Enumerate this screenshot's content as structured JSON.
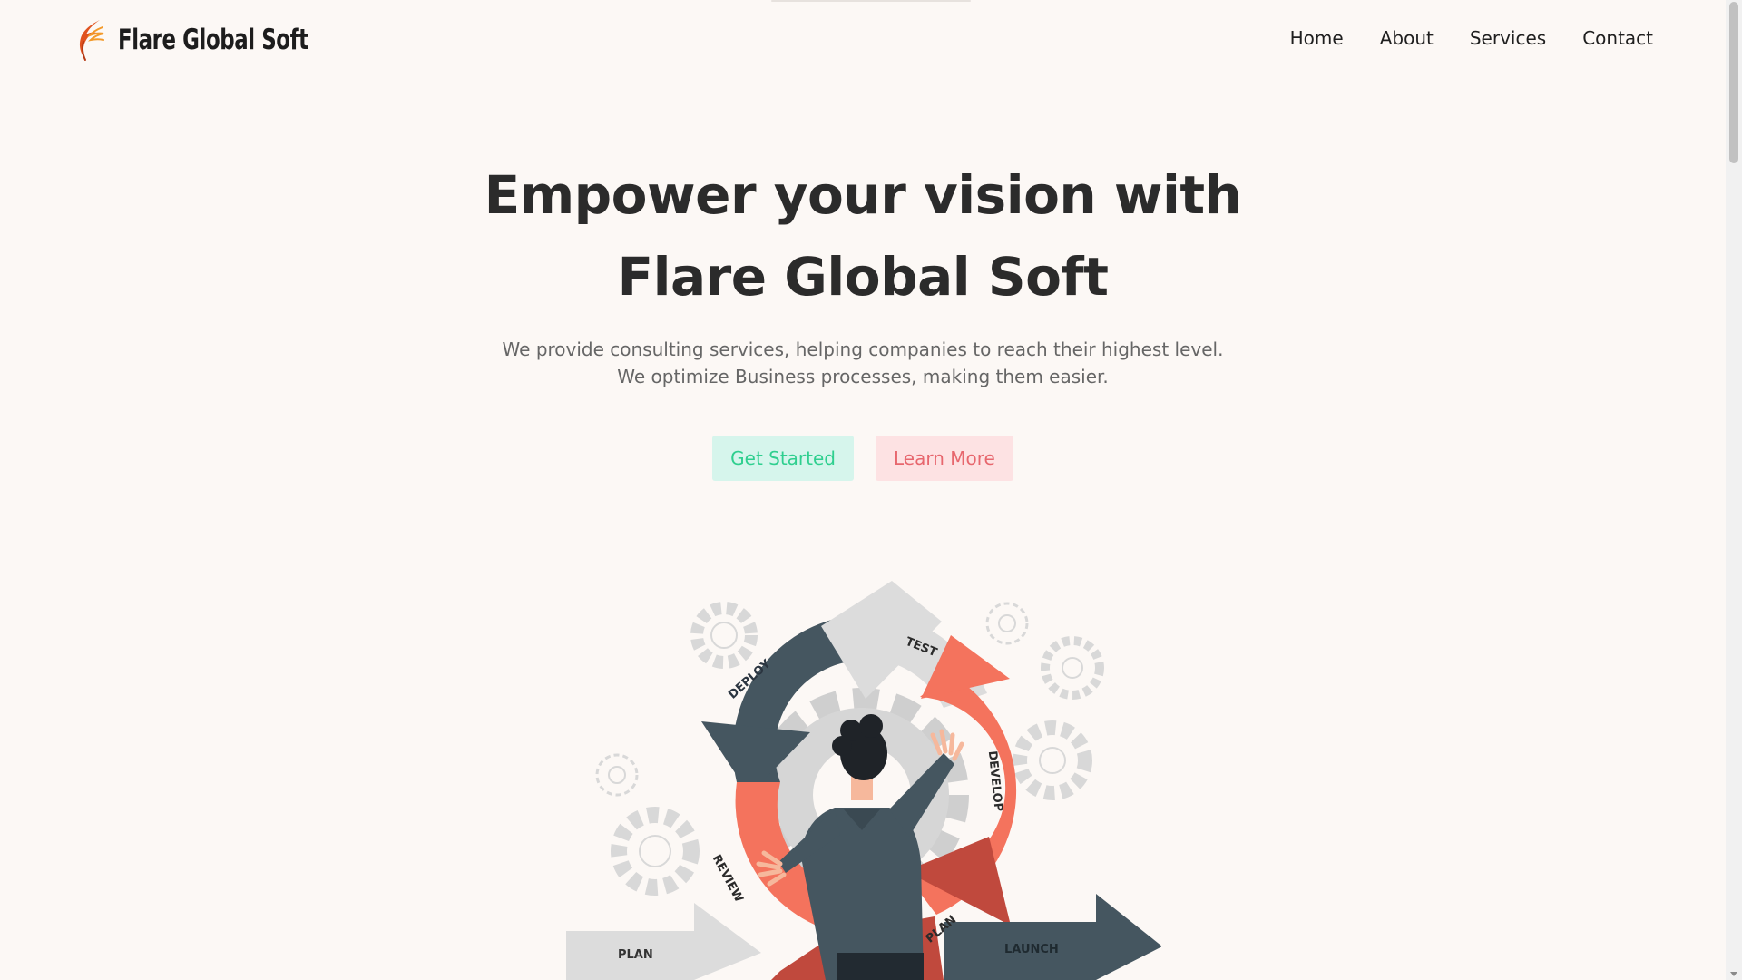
{
  "site": {
    "brand_name": "Flare Global Soft"
  },
  "nav": {
    "items": [
      {
        "label": "Home"
      },
      {
        "label": "About"
      },
      {
        "label": "Services"
      },
      {
        "label": "Contact"
      }
    ]
  },
  "hero": {
    "title_line1": "Empower your vision with",
    "title_line2": "Flare Global Soft",
    "subtitle_line1": "We provide consulting services, helping companies to reach their highest level.",
    "subtitle_line2": "We optimize Business processes, making them easier.",
    "primary_button": "Get Started",
    "secondary_button": "Learn More"
  },
  "illustration": {
    "labels": {
      "test": "TEST",
      "deploy": "DEPLOY",
      "develop": "DEVELOP",
      "review": "REVIEW",
      "plan_arc": "PLAN",
      "plan_arrow": "PLAN",
      "launch": "LAUNCH"
    }
  },
  "colors": {
    "background": "#fcf8f5",
    "heading": "#2b2b2b",
    "body_text": "#666666",
    "primary_button_bg": "#d6f5ec",
    "primary_button_text": "#2fcf8f",
    "secondary_button_bg": "#fde2e3",
    "secondary_button_text": "#e7676e",
    "illustration_dark": "#455660",
    "illustration_coral": "#f4735d",
    "illustration_red": "#c0493d",
    "illustration_light": "#dcdcdc"
  },
  "icons": {
    "logo": "flame-feather-icon",
    "scroll_down": "chevron-down-icon"
  }
}
